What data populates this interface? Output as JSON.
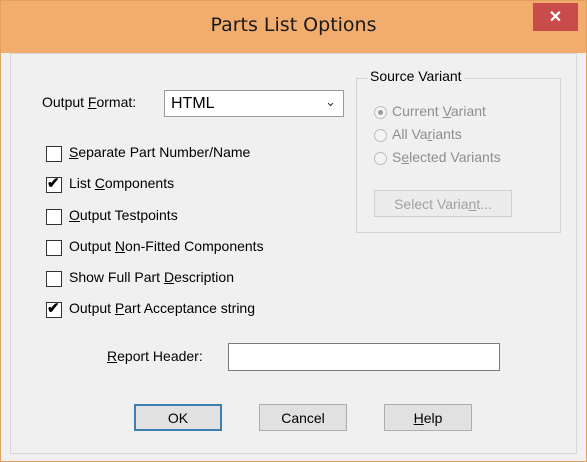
{
  "window": {
    "title": "Parts List Options",
    "close_label": "✕"
  },
  "output_format": {
    "label_pre": "Output ",
    "label_ul": "F",
    "label_post": "ormat:",
    "selected": "HTML",
    "arrow": "⌄"
  },
  "options": [
    {
      "pre": "",
      "ul": "S",
      "post": "eparate Part Number/Name",
      "checked": false
    },
    {
      "pre": "List ",
      "ul": "C",
      "post": "omponents",
      "checked": true
    },
    {
      "pre": "",
      "ul": "O",
      "post": "utput Testpoints",
      "checked": false
    },
    {
      "pre": "Output ",
      "ul": "N",
      "post": "on-Fitted Components",
      "checked": false
    },
    {
      "pre": "Show Full Part ",
      "ul": "D",
      "post": "escription",
      "checked": false
    },
    {
      "pre": "Output ",
      "ul": "P",
      "post": "art Acceptance string",
      "checked": true
    }
  ],
  "source_variant": {
    "title": "Source Variant",
    "radios": [
      {
        "pre": "Current ",
        "ul": "V",
        "post": "ariant",
        "selected": true
      },
      {
        "pre": "All Va",
        "ul": "r",
        "post": "iants",
        "selected": false
      },
      {
        "pre": "S",
        "ul": "e",
        "post": "lected Variants",
        "selected": false
      }
    ],
    "select_button": {
      "pre": "Select Varia",
      "ul": "n",
      "post": "t..."
    }
  },
  "report_header": {
    "label_pre": "",
    "label_ul": "R",
    "label_post": "eport Header:",
    "value": ""
  },
  "buttons": {
    "ok": "OK",
    "cancel": "Cancel",
    "help_ul": "H",
    "help_post": "elp"
  },
  "icons": {
    "check": "✔"
  }
}
